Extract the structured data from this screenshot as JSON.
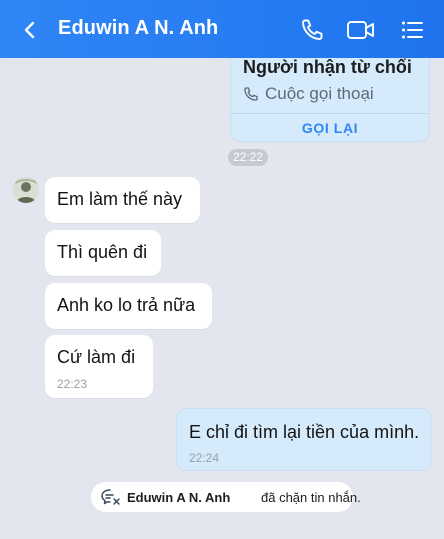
{
  "header": {
    "title": "Eduwin A N. Anh",
    "icons": [
      "back-chevron-icon",
      "phone-icon",
      "video-call-icon",
      "menu-list-icon"
    ]
  },
  "call_card": {
    "title": "Người nhận từ chối",
    "subtitle": "Cuộc gọi thoại",
    "action": "GỌI LẠI",
    "time": "22:22"
  },
  "messages_in": [
    {
      "text": "Em làm thế này"
    },
    {
      "text": "Thì quên đi"
    },
    {
      "text": "Anh ko lo trả nữa"
    },
    {
      "text": "Cứ làm đi",
      "time": "22:23"
    }
  ],
  "message_out": {
    "text": "E chỉ đi tìm lại tiền của mình.",
    "time": "22:24"
  },
  "notice": {
    "name": "Eduwin A N. Anh",
    "text": "đã chặn tin nhắn."
  },
  "colors": {
    "header_bg": "#2f86f6",
    "chat_bg": "#e3e6ee",
    "outgoing_bubble": "#d5eafb",
    "incoming_bubble": "#ffffff",
    "accent": "#2f86f6"
  }
}
